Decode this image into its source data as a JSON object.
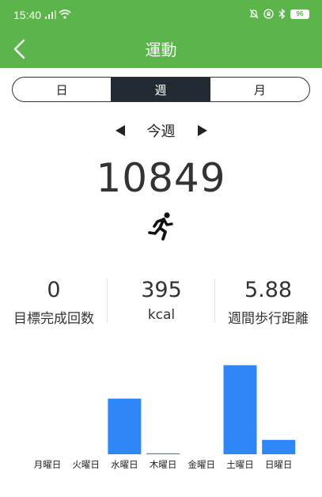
{
  "status": {
    "time": "15:40",
    "battery": "96"
  },
  "header": {
    "title": "運動"
  },
  "tabs": [
    {
      "label": "日",
      "active": false
    },
    {
      "label": "週",
      "active": true
    },
    {
      "label": "月",
      "active": false
    }
  ],
  "period": {
    "label": "今週"
  },
  "total": {
    "value": "10849"
  },
  "stats": [
    {
      "value": "0",
      "label": "目標完成回数"
    },
    {
      "value": "395",
      "label": "kcal"
    },
    {
      "value": "5.88",
      "label": "週間歩行距離"
    }
  ],
  "colors": {
    "header": "#5cb54a",
    "bar": "#2f86f6",
    "active_tab": "#222a33"
  },
  "chart_data": {
    "type": "bar",
    "categories": [
      "月曜日",
      "火曜日",
      "水曜日",
      "木曜日",
      "金曜日",
      "土曜日",
      "日曜日"
    ],
    "values": [
      0,
      0,
      3100,
      40,
      0,
      4960,
      800
    ],
    "ylim": [
      0,
      5200
    ],
    "grid": false
  }
}
